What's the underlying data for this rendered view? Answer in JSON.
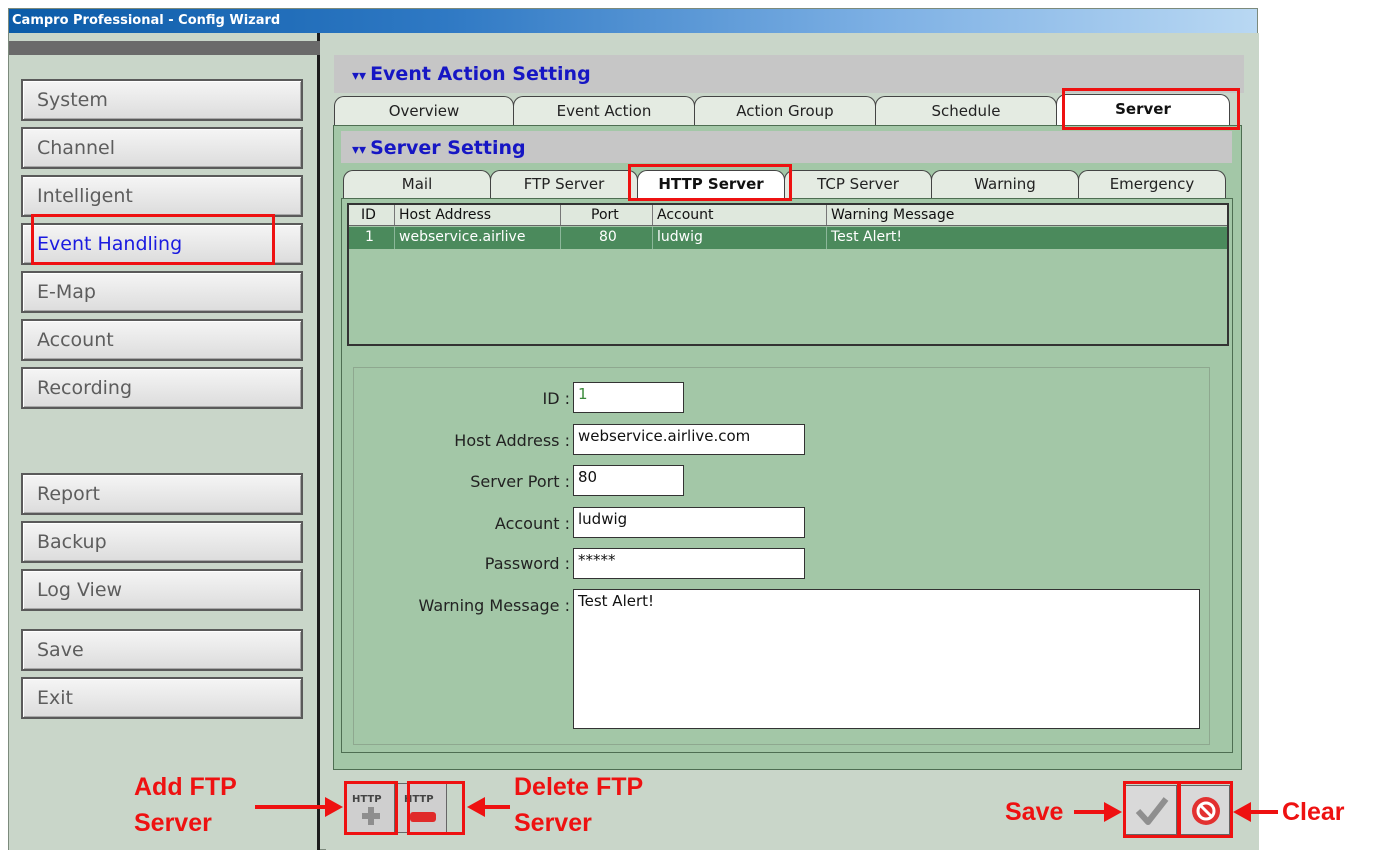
{
  "window": {
    "title": "Campro Professional - Config Wizard"
  },
  "sidebar": {
    "items": [
      {
        "label": "System"
      },
      {
        "label": "Channel"
      },
      {
        "label": "Intelligent"
      },
      {
        "label": "Event Handling",
        "active": true
      },
      {
        "label": "E-Map"
      },
      {
        "label": "Account"
      },
      {
        "label": "Recording"
      },
      {
        "label": "Report"
      },
      {
        "label": "Backup"
      },
      {
        "label": "Log View"
      },
      {
        "label": "Save"
      },
      {
        "label": "Exit"
      }
    ]
  },
  "main": {
    "title": "Event Action Setting",
    "tabs": [
      {
        "label": "Overview"
      },
      {
        "label": "Event Action"
      },
      {
        "label": "Action Group"
      },
      {
        "label": "Schedule"
      },
      {
        "label": "Server",
        "selected": true
      }
    ],
    "server_title": "Server Setting",
    "server_tabs": [
      {
        "label": "Mail"
      },
      {
        "label": "FTP Server"
      },
      {
        "label": "HTTP Server",
        "selected": true
      },
      {
        "label": "TCP Server"
      },
      {
        "label": "Warning"
      },
      {
        "label": "Emergency"
      }
    ]
  },
  "table": {
    "columns": [
      "ID",
      "Host Address",
      "Port",
      "Account",
      "Warning Message"
    ],
    "rows": [
      [
        "1",
        "webservice.airlive",
        "80",
        "ludwig",
        "Test Alert!"
      ]
    ]
  },
  "form": {
    "id_label": "ID :",
    "id_value": "1",
    "host_label": "Host Address :",
    "host_value": "webservice.airlive.com",
    "port_label": "Server Port :",
    "port_value": "80",
    "account_label": "Account :",
    "account_value": "ludwig",
    "password_label": "Password :",
    "password_value": "*****",
    "message_label": "Warning Message :",
    "message_value": "Test Alert!"
  },
  "toolbar": {
    "add_icon_text": "HTTP",
    "delete_icon_text": "HTTP"
  },
  "annotations": {
    "add_line1": "Add FTP",
    "add_line2": "Server",
    "delete_line1": "Delete FTP",
    "delete_line2": "Server",
    "save": "Save",
    "clear": "Clear"
  },
  "colors": {
    "panel_green": "#a3c7a7",
    "selected_row": "#4b8a5c",
    "annotation_red": "#ee1111",
    "header_blue": "#1616c4"
  }
}
